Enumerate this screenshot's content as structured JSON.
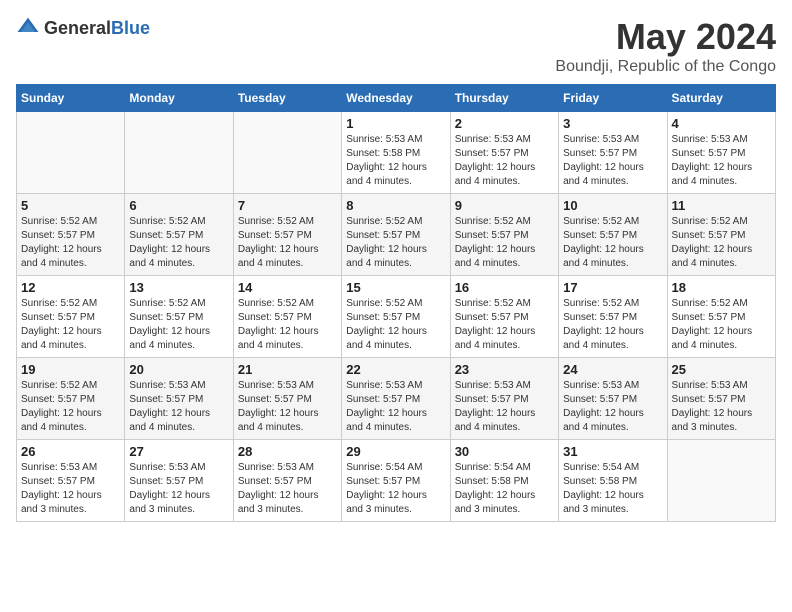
{
  "header": {
    "logo_general": "General",
    "logo_blue": "Blue",
    "main_title": "May 2024",
    "subtitle": "Boundji, Republic of the Congo"
  },
  "days_of_week": [
    "Sunday",
    "Monday",
    "Tuesday",
    "Wednesday",
    "Thursday",
    "Friday",
    "Saturday"
  ],
  "weeks": [
    [
      {
        "day": "",
        "info": ""
      },
      {
        "day": "",
        "info": ""
      },
      {
        "day": "",
        "info": ""
      },
      {
        "day": "1",
        "info": "Sunrise: 5:53 AM\nSunset: 5:58 PM\nDaylight: 12 hours\nand 4 minutes."
      },
      {
        "day": "2",
        "info": "Sunrise: 5:53 AM\nSunset: 5:57 PM\nDaylight: 12 hours\nand 4 minutes."
      },
      {
        "day": "3",
        "info": "Sunrise: 5:53 AM\nSunset: 5:57 PM\nDaylight: 12 hours\nand 4 minutes."
      },
      {
        "day": "4",
        "info": "Sunrise: 5:53 AM\nSunset: 5:57 PM\nDaylight: 12 hours\nand 4 minutes."
      }
    ],
    [
      {
        "day": "5",
        "info": "Sunrise: 5:52 AM\nSunset: 5:57 PM\nDaylight: 12 hours\nand 4 minutes."
      },
      {
        "day": "6",
        "info": "Sunrise: 5:52 AM\nSunset: 5:57 PM\nDaylight: 12 hours\nand 4 minutes."
      },
      {
        "day": "7",
        "info": "Sunrise: 5:52 AM\nSunset: 5:57 PM\nDaylight: 12 hours\nand 4 minutes."
      },
      {
        "day": "8",
        "info": "Sunrise: 5:52 AM\nSunset: 5:57 PM\nDaylight: 12 hours\nand 4 minutes."
      },
      {
        "day": "9",
        "info": "Sunrise: 5:52 AM\nSunset: 5:57 PM\nDaylight: 12 hours\nand 4 minutes."
      },
      {
        "day": "10",
        "info": "Sunrise: 5:52 AM\nSunset: 5:57 PM\nDaylight: 12 hours\nand 4 minutes."
      },
      {
        "day": "11",
        "info": "Sunrise: 5:52 AM\nSunset: 5:57 PM\nDaylight: 12 hours\nand 4 minutes."
      }
    ],
    [
      {
        "day": "12",
        "info": "Sunrise: 5:52 AM\nSunset: 5:57 PM\nDaylight: 12 hours\nand 4 minutes."
      },
      {
        "day": "13",
        "info": "Sunrise: 5:52 AM\nSunset: 5:57 PM\nDaylight: 12 hours\nand 4 minutes."
      },
      {
        "day": "14",
        "info": "Sunrise: 5:52 AM\nSunset: 5:57 PM\nDaylight: 12 hours\nand 4 minutes."
      },
      {
        "day": "15",
        "info": "Sunrise: 5:52 AM\nSunset: 5:57 PM\nDaylight: 12 hours\nand 4 minutes."
      },
      {
        "day": "16",
        "info": "Sunrise: 5:52 AM\nSunset: 5:57 PM\nDaylight: 12 hours\nand 4 minutes."
      },
      {
        "day": "17",
        "info": "Sunrise: 5:52 AM\nSunset: 5:57 PM\nDaylight: 12 hours\nand 4 minutes."
      },
      {
        "day": "18",
        "info": "Sunrise: 5:52 AM\nSunset: 5:57 PM\nDaylight: 12 hours\nand 4 minutes."
      }
    ],
    [
      {
        "day": "19",
        "info": "Sunrise: 5:52 AM\nSunset: 5:57 PM\nDaylight: 12 hours\nand 4 minutes."
      },
      {
        "day": "20",
        "info": "Sunrise: 5:53 AM\nSunset: 5:57 PM\nDaylight: 12 hours\nand 4 minutes."
      },
      {
        "day": "21",
        "info": "Sunrise: 5:53 AM\nSunset: 5:57 PM\nDaylight: 12 hours\nand 4 minutes."
      },
      {
        "day": "22",
        "info": "Sunrise: 5:53 AM\nSunset: 5:57 PM\nDaylight: 12 hours\nand 4 minutes."
      },
      {
        "day": "23",
        "info": "Sunrise: 5:53 AM\nSunset: 5:57 PM\nDaylight: 12 hours\nand 4 minutes."
      },
      {
        "day": "24",
        "info": "Sunrise: 5:53 AM\nSunset: 5:57 PM\nDaylight: 12 hours\nand 4 minutes."
      },
      {
        "day": "25",
        "info": "Sunrise: 5:53 AM\nSunset: 5:57 PM\nDaylight: 12 hours\nand 3 minutes."
      }
    ],
    [
      {
        "day": "26",
        "info": "Sunrise: 5:53 AM\nSunset: 5:57 PM\nDaylight: 12 hours\nand 3 minutes."
      },
      {
        "day": "27",
        "info": "Sunrise: 5:53 AM\nSunset: 5:57 PM\nDaylight: 12 hours\nand 3 minutes."
      },
      {
        "day": "28",
        "info": "Sunrise: 5:53 AM\nSunset: 5:57 PM\nDaylight: 12 hours\nand 3 minutes."
      },
      {
        "day": "29",
        "info": "Sunrise: 5:54 AM\nSunset: 5:57 PM\nDaylight: 12 hours\nand 3 minutes."
      },
      {
        "day": "30",
        "info": "Sunrise: 5:54 AM\nSunset: 5:58 PM\nDaylight: 12 hours\nand 3 minutes."
      },
      {
        "day": "31",
        "info": "Sunrise: 5:54 AM\nSunset: 5:58 PM\nDaylight: 12 hours\nand 3 minutes."
      },
      {
        "day": "",
        "info": ""
      }
    ]
  ]
}
